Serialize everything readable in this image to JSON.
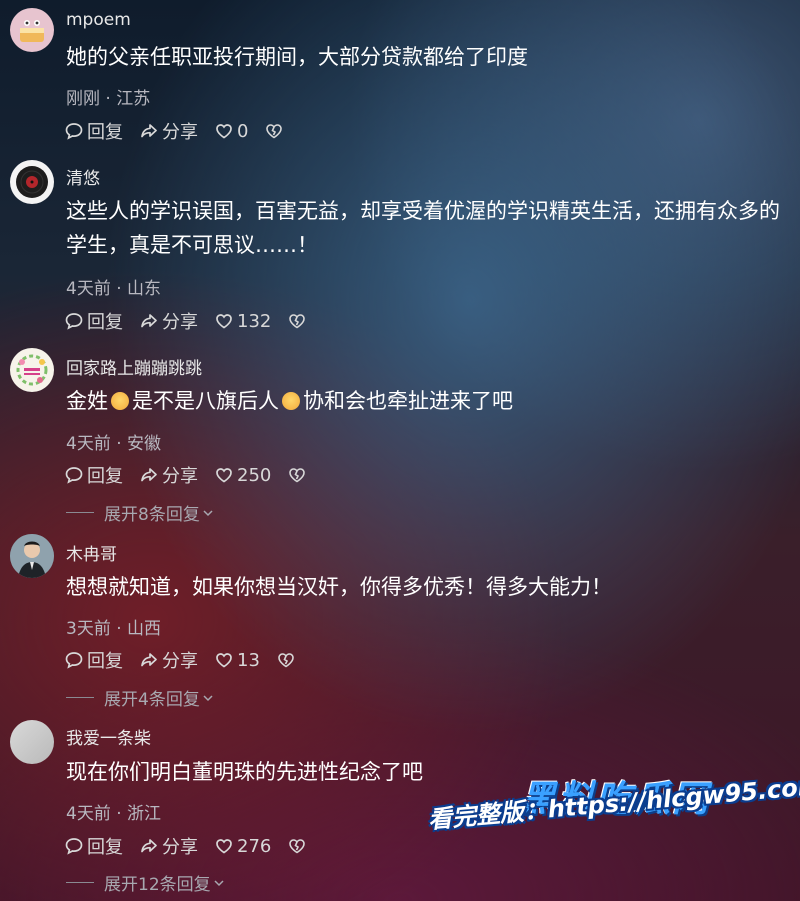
{
  "comments": [
    {
      "username": "mpoem",
      "text": "她的父亲任职亚投行期间，大部分贷款都给了印度",
      "meta": "刚刚 · 江苏",
      "reply_label": "回复",
      "share_label": "分享",
      "likes": "0",
      "avatar_icon": "cake-avatar"
    },
    {
      "username": "清悠",
      "text": "这些人的学识误国，百害无益，却享受着优渥的学识精英生活，还拥有众多的学生，真是不可思议……！",
      "meta": "4天前 · 山东",
      "reply_label": "回复",
      "share_label": "分享",
      "likes": "132",
      "avatar_icon": "vinyl-record-avatar"
    },
    {
      "username": "回家路上蹦蹦跳跳",
      "text_parts": [
        "金姓",
        "是不是八旗后人",
        "协和会也牵扯进来了吧"
      ],
      "meta": "4天前 · 安徽",
      "reply_label": "回复",
      "share_label": "分享",
      "likes": "250",
      "expand_label": "展开8条回复",
      "avatar_icon": "flower-wreath-avatar"
    },
    {
      "username": "木冉哥",
      "text": "想想就知道，如果你想当汉奸，你得多优秀！得多大能力！",
      "meta": "3天前 · 山西",
      "reply_label": "回复",
      "share_label": "分享",
      "likes": "13",
      "expand_label": "展开4条回复",
      "avatar_icon": "man-portrait-avatar"
    },
    {
      "username": "我爱一条柴",
      "text": "现在你们明白董明珠的先进性纪念了吧",
      "meta": "4天前 · 浙江",
      "reply_label": "回复",
      "share_label": "分享",
      "likes": "276",
      "expand_label": "展开12条回复",
      "avatar_icon": "blank-avatar"
    }
  ],
  "watermark": {
    "logo": "黑料吃瓜网",
    "url": "看完整版：https://hlcgw95.com"
  },
  "colors": {
    "accent_watermark": "#3aa0ff",
    "watermark_outline": "#0a3d8f"
  }
}
